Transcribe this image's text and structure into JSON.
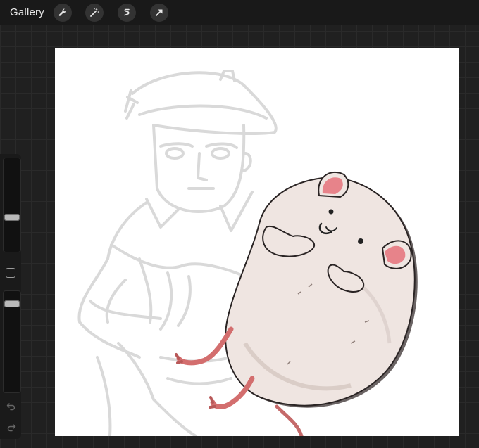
{
  "topbar": {
    "gallery_label": "Gallery",
    "tools": [
      {
        "icon": "wrench-icon",
        "name": "actions"
      },
      {
        "icon": "magic-wand-icon",
        "name": "adjustments"
      },
      {
        "icon": "selection-s-icon",
        "name": "selection"
      },
      {
        "icon": "arrow-cursor-icon",
        "name": "transform"
      }
    ]
  },
  "sidebar": {
    "brush_size": 0.36,
    "opacity": 0.9,
    "icons": {
      "modify": "square-icon",
      "undo": "undo-arrow-icon",
      "redo": "redo-arrow-icon"
    }
  },
  "colors": {
    "ui_background": "#202020",
    "canvas": "#ffffff",
    "sketch_line": "#d6d6d6",
    "hamster_fur": "#efe5e1",
    "hamster_ear": "#e7838a",
    "ink": "#222222"
  }
}
